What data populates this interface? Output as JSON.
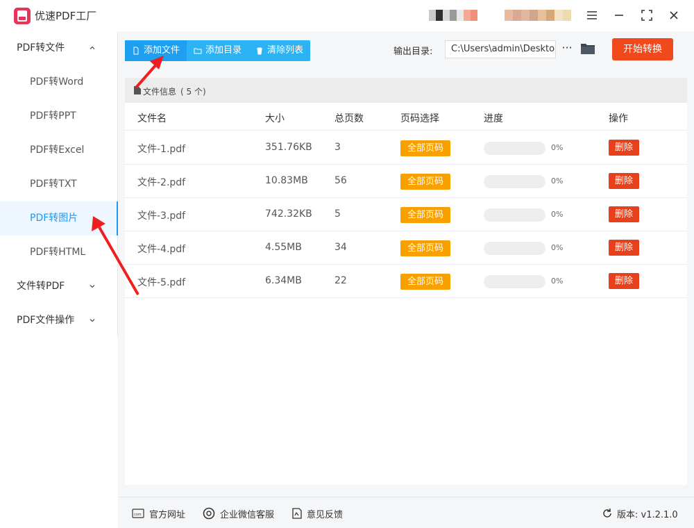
{
  "app": {
    "title": "优速PDF工厂",
    "icons": {
      "menu": "hamburger-icon",
      "minimize": "minimize-icon",
      "maximize": "maximize-icon",
      "close": "close-icon"
    }
  },
  "sidebar": {
    "groups": [
      {
        "label": "PDF转文件",
        "expanded": true,
        "items": [
          {
            "label": "PDF转Word",
            "active": false
          },
          {
            "label": "PDF转PPT",
            "active": false
          },
          {
            "label": "PDF转Excel",
            "active": false
          },
          {
            "label": "PDF转TXT",
            "active": false
          },
          {
            "label": "PDF转图片",
            "active": true
          },
          {
            "label": "PDF转HTML",
            "active": false
          }
        ]
      },
      {
        "label": "文件转PDF",
        "expanded": false,
        "items": []
      },
      {
        "label": "PDF文件操作",
        "expanded": false,
        "items": []
      }
    ]
  },
  "toolbar": {
    "add_file": "添加文件",
    "add_folder": "添加目录",
    "clear_list": "清除列表",
    "output_label": "输出目录:",
    "output_path": "C:\\Users\\admin\\Deskto",
    "more": "···",
    "start": "开始转换"
  },
  "file_panel": {
    "title": "文件信息",
    "count_text": "( 5 个)",
    "columns": [
      "文件名",
      "大小",
      "总页数",
      "页码选择",
      "进度",
      "操作"
    ],
    "rows": [
      {
        "name": "文件-1.pdf",
        "size": "351.76KB",
        "pages": "3",
        "page_select": "全部页码",
        "progress": 0,
        "progress_text": "0%",
        "action": "删除"
      },
      {
        "name": "文件-2.pdf",
        "size": "10.83MB",
        "pages": "56",
        "page_select": "全部页码",
        "progress": 0,
        "progress_text": "0%",
        "action": "删除"
      },
      {
        "name": "文件-3.pdf",
        "size": "742.32KB",
        "pages": "5",
        "page_select": "全部页码",
        "progress": 0,
        "progress_text": "0%",
        "action": "删除"
      },
      {
        "name": "文件-4.pdf",
        "size": "4.55MB",
        "pages": "34",
        "page_select": "全部页码",
        "progress": 0,
        "progress_text": "0%",
        "action": "删除"
      },
      {
        "name": "文件-5.pdf",
        "size": "6.34MB",
        "pages": "22",
        "page_select": "全部页码",
        "progress": 0,
        "progress_text": "0%",
        "action": "删除"
      }
    ]
  },
  "footer": {
    "website": "官方网址",
    "wechat_service": "企业微信客服",
    "feedback": "意见反馈",
    "version": "版本: v1.2.1.0"
  },
  "colors": {
    "accent_blue": "#2cb3f5",
    "start_red": "#f04a1c",
    "page_orange": "#f7a000",
    "delete_red": "#e8401c",
    "active_text": "#2196f3"
  }
}
